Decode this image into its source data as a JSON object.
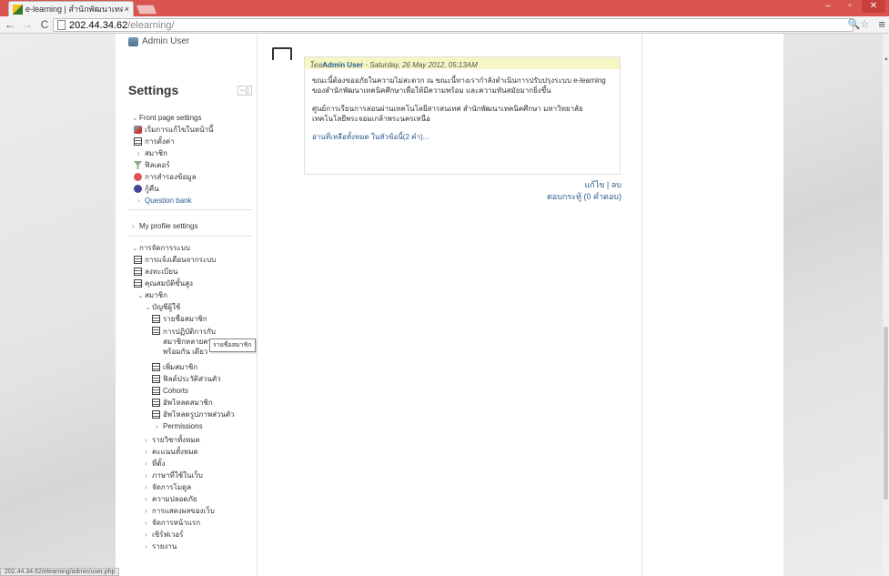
{
  "browser": {
    "tab_title": "e-learning | สำนักพัฒนาเทค",
    "tab_close": "×",
    "url_host": "202.44.34.62",
    "url_path": "/elearning/",
    "status_url": "202.44.34.62/elearning/admin/user.php",
    "win_minimize": "–",
    "win_maximize": "▫",
    "win_close": "✕",
    "back": "←",
    "forward": "→",
    "reload": "C",
    "omni_right": "🔍☆",
    "menu": "≡"
  },
  "sidebar": {
    "admin_user": "Admin User",
    "settings_title": "Settings",
    "dock_icon": "−▯",
    "front_page": {
      "label": "Front page settings",
      "items": [
        "เริ่มการแก้ไขในหน้านี้",
        "การตั้งค่า",
        "สมาชิก",
        "ฟิลเตอร์",
        "การสำรองข้อมูล",
        "กู้คืน",
        "Question bank"
      ]
    },
    "my_profile": "My profile settings",
    "site_admin": {
      "label": "การจัดการระบบ",
      "items": [
        "การแจ้งเตือนจากระบบ",
        "ลงทะเบียน",
        "คุณสมบัติขั้นสูง"
      ],
      "users_label": "สมาชิก",
      "accounts_label": "บัญชีผู้ใช้",
      "accounts": [
        "รายชื่อสมาชิก",
        "การปฏิบัติการกับสมาชิกหลายคนพร้อมกัน เดียว",
        "เพิ่มสมาชิก",
        "ฟิลด์ประวัติส่วนตัว",
        "Cohorts",
        "อัพโหลดสมาชิก",
        "อัพโหลดรูปภาพส่วนตัว"
      ],
      "permissions": "Permissions",
      "others": [
        "รายวิชาทั้งหมด",
        "คะแนนทั้งหมด",
        "ที่ตั้ง",
        "ภาษาที่ใช้ในเว็บ",
        "จัดการโมดูล",
        "ความปลอดภัย",
        "การแสดงผลของเว็บ",
        "จัดการหน้าแรก",
        "เซิร์ฟเวอร์",
        "รายงาน"
      ]
    },
    "tooltip": "รายชื่อสมาชิก"
  },
  "post": {
    "by": "โดย",
    "author": "Admin User",
    "date": " - Saturday, 26 May 2012, 05:13AM",
    "p1": "ขณะนี้ต้องขออภัยในความไม่สะดวก ณ ขณะนี้ทางเรากำลังดำเนินการปรับปรุงระบบ e-learning ของสำนักพัฒนาเทคนิคศึกษาเพื่อให้มีความพร้อม และความทันสมัยมากยิ่งขึ้น",
    "p2": "ศูนย์การเรียนการสอนผ่านเทคโนโลยีสารสนเทศ สำนักพัฒนาเทคนิคศึกษา มหาวิทยาลัยเทคโนโลยีพระจอมเกล้าพระนครเหนือ",
    "more": "อ่านที่เหลือทั้งหมด ในหัวข้อนี้(2 คำ)...",
    "edit_delete": "แก้ไข | ลบ",
    "replies": "ตอบกระทู้ (0 คำตอบ)"
  }
}
